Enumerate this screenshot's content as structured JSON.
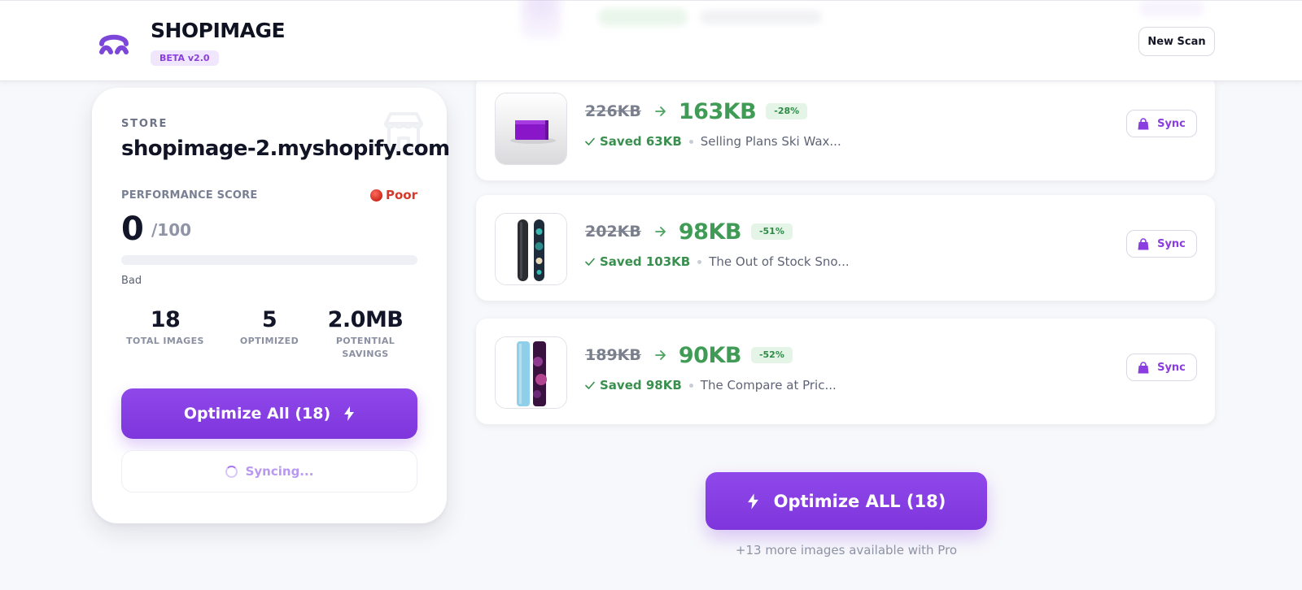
{
  "header": {
    "brand": "SHOPIMAGE",
    "badge": "BETA v2.0",
    "new_scan_label": "New Scan"
  },
  "store": {
    "kicker": "STORE",
    "name": "shopimage-2.myshopify.com",
    "performance_label": "PERFORMANCE SCORE",
    "status_label": "Poor",
    "score": "0",
    "score_max": "/100",
    "score_progress": 0,
    "score_word": "Bad",
    "stats": [
      {
        "value": "18",
        "label": "TOTAL IMAGES"
      },
      {
        "value": "5",
        "label": "OPTIMIZED"
      },
      {
        "value": "2.0MB",
        "label": "POTENTIAL SAVINGS"
      }
    ],
    "optimize_all_label": "Optimize All (18)",
    "syncing_label": "Syncing..."
  },
  "products": [
    {
      "old_size": "226KB",
      "new_size": "163KB",
      "reduction": "-28%",
      "saved": "Saved 63KB",
      "title": "Selling Plans Ski Wax...",
      "sync_label": "Sync",
      "thumb": "ski-wax"
    },
    {
      "old_size": "202KB",
      "new_size": "98KB",
      "reduction": "-51%",
      "saved": "Saved 103KB",
      "title": "The Out of Stock Sno...",
      "sync_label": "Sync",
      "thumb": "snowboard-dark"
    },
    {
      "old_size": "189KB",
      "new_size": "90KB",
      "reduction": "-52%",
      "saved": "Saved 98KB",
      "title": "The Compare at Pric...",
      "sync_label": "Sync",
      "thumb": "snowboard-blue-purple"
    }
  ],
  "cta": {
    "label": "Optimize ALL (18)",
    "pro_note": "+13 more images available with Pro"
  },
  "colors": {
    "accent": "#8a3ee0",
    "success": "#3f9b55",
    "danger": "#d33a2c"
  },
  "icons": [
    "logo-icon",
    "store-icon",
    "red-dot-icon",
    "lightning-icon",
    "spinner-icon",
    "arrow-right-icon",
    "check-icon",
    "shopping-bag-icon"
  ]
}
